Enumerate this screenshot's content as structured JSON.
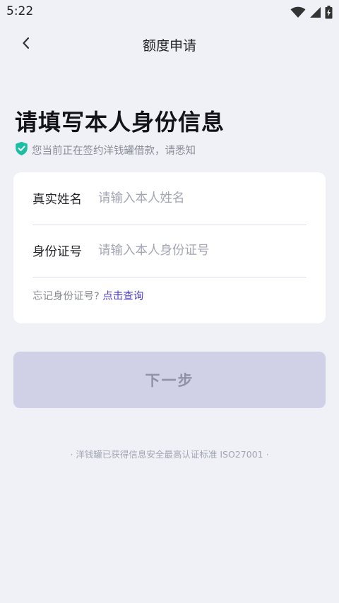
{
  "status_bar": {
    "time": "5:22",
    "icons": [
      "wifi-icon",
      "signal-icon",
      "battery-icon"
    ]
  },
  "nav": {
    "back_icon": "chevron-left-icon",
    "title": "额度申请"
  },
  "heading": "请填写本人身份信息",
  "notice": {
    "icon": "shield-check-icon",
    "text": "您当前正在签约洋钱罐借款，请悉知"
  },
  "form": {
    "name_label": "真实姓名",
    "name_placeholder": "请输入本人姓名",
    "name_value": "",
    "id_label": "身份证号",
    "id_placeholder": "请输入本人身份证号",
    "id_value": "",
    "forgot_text": "忘记身份证号?",
    "lookup_link": "点击查询"
  },
  "next_button": {
    "label": "下一步",
    "enabled": false
  },
  "footer": "· 洋钱罐已获得信息安全最高认证标准 ISO27001 ·",
  "colors": {
    "background": "#eff1f7",
    "card": "#ffffff",
    "accent_link": "#4b3fd1",
    "shield": "#1dbfa4",
    "button_disabled": "#d0d1e7"
  }
}
